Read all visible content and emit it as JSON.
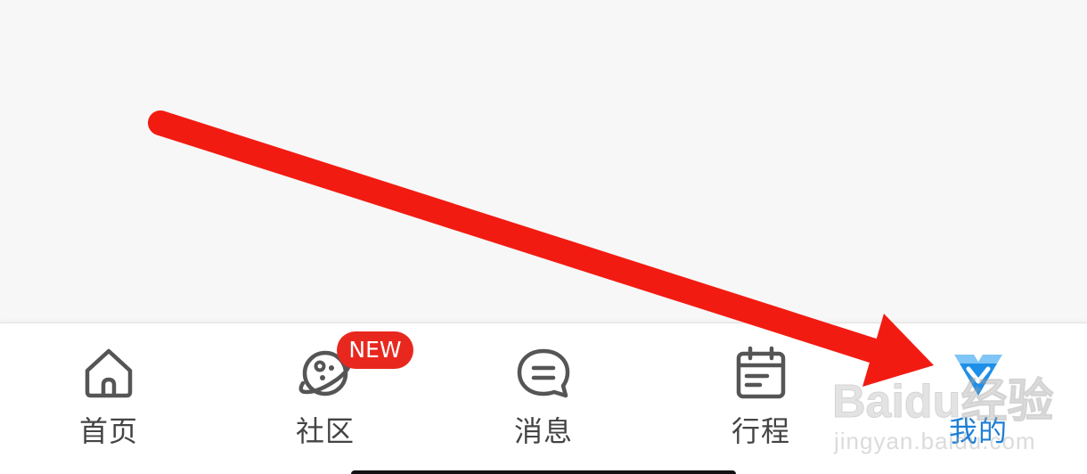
{
  "tab_bar": {
    "tabs": [
      {
        "label": "首页",
        "icon": "home-icon"
      },
      {
        "label": "社区",
        "icon": "community-planet-icon",
        "badge": "NEW"
      },
      {
        "label": "消息",
        "icon": "message-bubble-icon"
      },
      {
        "label": "行程",
        "icon": "calendar-icon"
      },
      {
        "label": "我的",
        "icon": "profile-diamond-icon",
        "active": true
      }
    ]
  },
  "watermark": {
    "brand": "Baidu经验",
    "site": "jingyan.baidu.com"
  },
  "colors": {
    "active_tab": "#1e7fd6",
    "inactive_tab": "#444444",
    "badge": "#e8281e",
    "annotation_arrow": "#f21b12",
    "content_background": "#f7f7f7"
  }
}
